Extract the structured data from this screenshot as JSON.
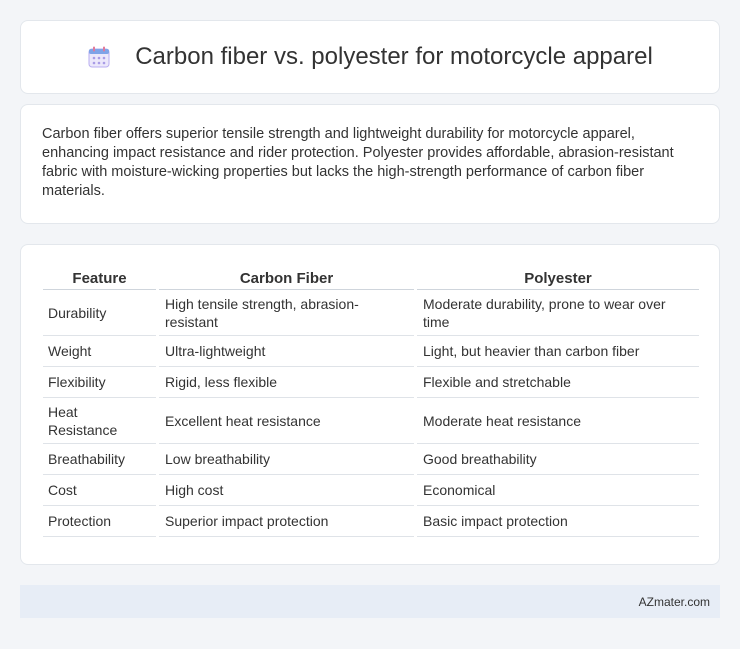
{
  "header": {
    "title": "Carbon fiber vs. polyester for motorcycle apparel",
    "icon": "calendar-icon"
  },
  "summary": {
    "text": "Carbon fiber offers superior tensile strength and lightweight durability for motorcycle apparel, enhancing impact resistance and rider protection. Polyester provides affordable, abrasion-resistant fabric with moisture-wicking properties but lacks the high-strength performance of carbon fiber materials."
  },
  "table": {
    "headers": [
      "Feature",
      "Carbon Fiber",
      "Polyester"
    ],
    "rows": [
      [
        "Durability",
        "High tensile strength, abrasion-resistant",
        "Moderate durability, prone to wear over time"
      ],
      [
        "Weight",
        "Ultra-lightweight",
        "Light, but heavier than carbon fiber"
      ],
      [
        "Flexibility",
        "Rigid, less flexible",
        "Flexible and stretchable"
      ],
      [
        "Heat Resistance",
        "Excellent heat resistance",
        "Moderate heat resistance"
      ],
      [
        "Breathability",
        "Low breathability",
        "Good breathability"
      ],
      [
        "Cost",
        "High cost",
        "Economical"
      ],
      [
        "Protection",
        "Superior impact protection",
        "Basic impact protection"
      ]
    ]
  },
  "footer": {
    "brand": "AZmater.com"
  },
  "colors": {
    "page_bg": "#f3f5f8",
    "card_bg": "#ffffff",
    "footer_bg": "#e7edf6",
    "icon_accent": "#8b7fd6"
  }
}
